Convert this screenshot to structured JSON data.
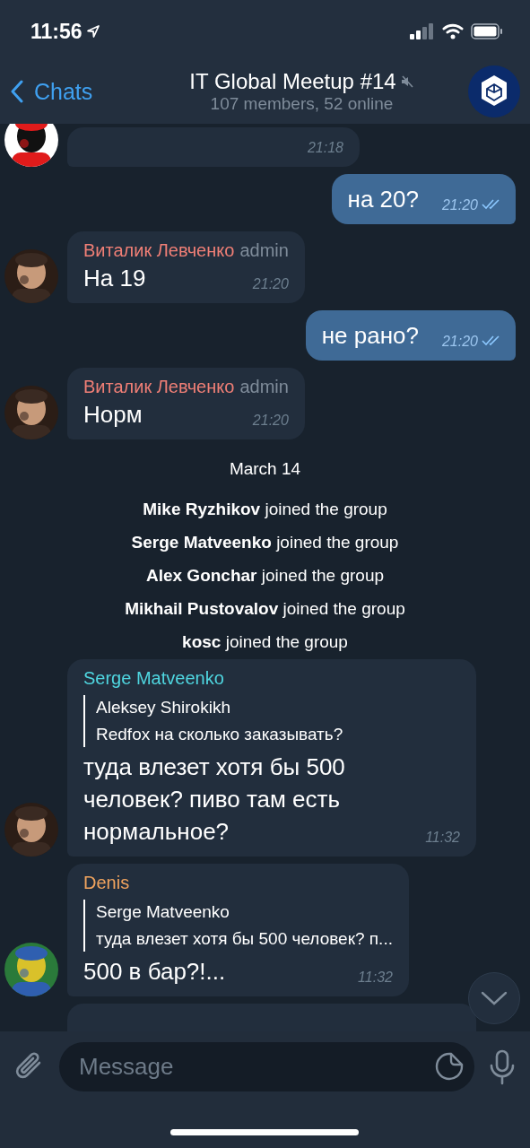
{
  "status_bar": {
    "time": "11:56"
  },
  "header": {
    "back": "Chats",
    "title": "IT Global Meetup #14",
    "muted": true,
    "subtitle": "107 members, 52 online"
  },
  "messages": [
    {
      "kind": "incoming",
      "time": "21:18"
    },
    {
      "kind": "outgoing",
      "text": "на 20?",
      "time": "21:20",
      "read": true
    },
    {
      "kind": "incoming",
      "sender": "Виталик Левченко",
      "color": "#f07f76",
      "role": "admin",
      "text": "На 19",
      "time": "21:20"
    },
    {
      "kind": "outgoing",
      "text": "не рано?",
      "time": "21:20",
      "read": true
    },
    {
      "kind": "incoming",
      "sender": "Виталик Левченко",
      "color": "#f07f76",
      "role": "admin",
      "text": "Норм",
      "time": "21:20"
    },
    {
      "kind": "date",
      "text": "March 14"
    },
    {
      "kind": "service",
      "text": "**Mike Ryzhikov** joined the group"
    },
    {
      "kind": "service",
      "text": "**Serge Matveenko** joined the group"
    },
    {
      "kind": "service",
      "text": "**Alex Gonchar** joined the group"
    },
    {
      "kind": "service",
      "text": "**Mikhail Pustovalov** joined the group"
    },
    {
      "kind": "service",
      "text": "**kosc** joined the group"
    },
    {
      "kind": "incoming",
      "sender": "Serge Matveenko",
      "color": "#4fd6e0",
      "reply": {
        "author": "Aleksey Shirokikh",
        "text": "Redfox на сколько заказывать?"
      },
      "text": "туда влезет хотя бы 500 человек? пиво там есть нормальное?",
      "time": "11:32"
    },
    {
      "kind": "incoming",
      "sender": "Denis",
      "color": "#f0a35e",
      "reply": {
        "author": "Serge Matveenko",
        "text": "туда влезет хотя бы 500 человек? п..."
      },
      "text": "500 в бар?!...",
      "time": "11:32"
    },
    {
      "kind": "partial"
    }
  ],
  "input": {
    "placeholder": "Message"
  }
}
